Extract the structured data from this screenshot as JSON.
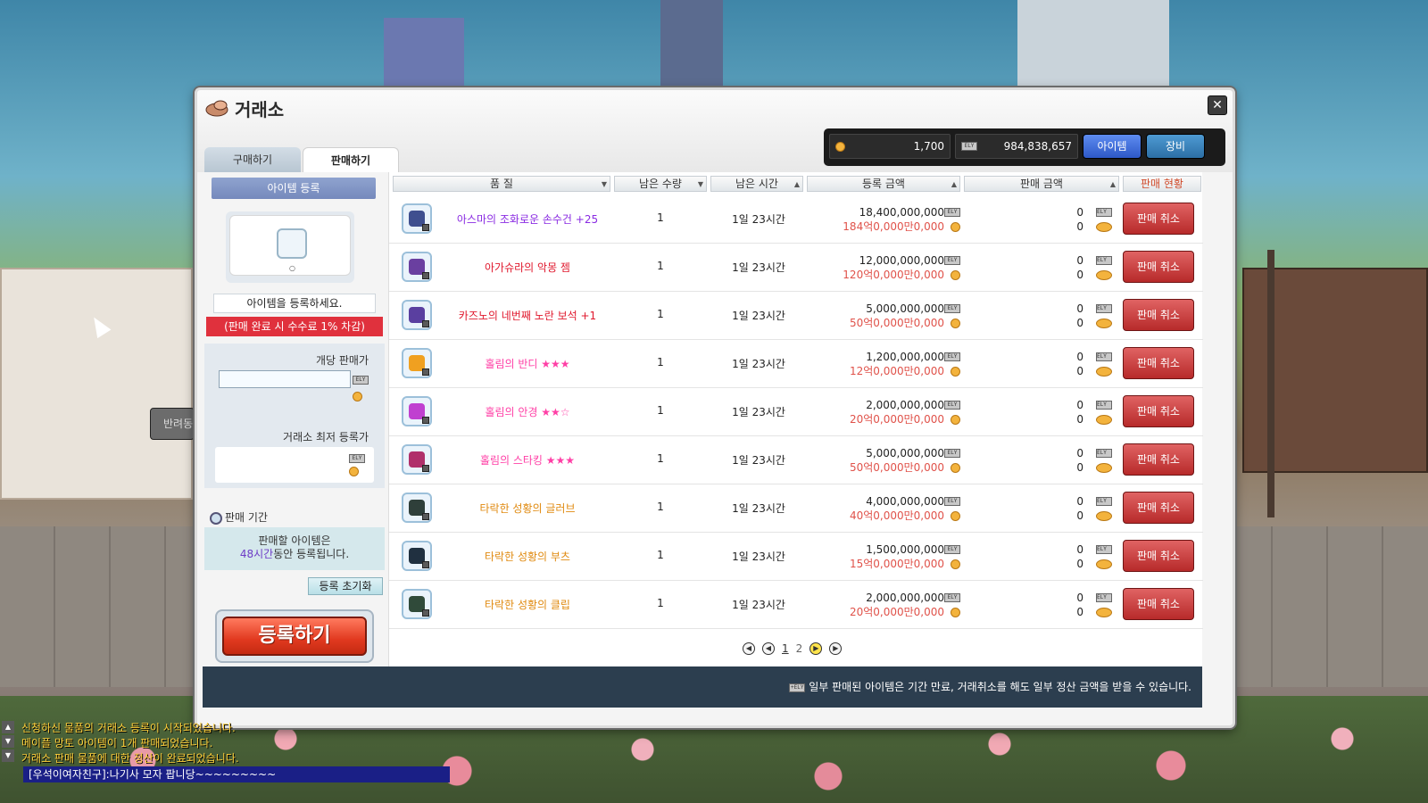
{
  "window": {
    "title": "거래소",
    "close_label": "✕"
  },
  "currency": {
    "coin_amount": "1,700",
    "meso_amount": "984,838,657",
    "meso_label": "ELY",
    "coin_label": "₩"
  },
  "view_toggle": {
    "item_label": "아이템",
    "equip_label": "장비"
  },
  "tabs": {
    "buy": "구매하기",
    "sell": "판매하기"
  },
  "register": {
    "header": "아이템 등록",
    "prompt": "아이템을 등록하세요.",
    "fee_note": "(판매 완료 시 수수료 1% 차감)",
    "unit_price_label": "개당 판매가",
    "unit_price_value": "",
    "lowest_label": "거래소 최저 등록가",
    "period_label": "판매 기간",
    "period_line1": "판매할 아이템은",
    "period_hours": "48시간",
    "period_line2_suffix": "동안 등록됩니다.",
    "reset_label": "등록 초기화",
    "submit_label": "등록하기"
  },
  "table": {
    "columns": [
      "품 질",
      "남은 수량",
      "남은 시간",
      "등록 금액",
      "판매 금액",
      "판매 현황"
    ],
    "rows": [
      {
        "name": "아스마의 조화로운 손수건 +25",
        "name_color": "#8a2be2",
        "qty": "1",
        "time": "1일 23시간",
        "price": "18,400,000,000",
        "price_coin": "184억0,000만0,000",
        "sale_meso": "0",
        "sale_coin": "0",
        "action": "판매 취소",
        "icon": "handkerchief-icon",
        "icon_color": "#3f4f8f"
      },
      {
        "name": "아가슈라의 악몽 젬",
        "name_color": "#e0182d",
        "qty": "1",
        "time": "1일 23시간",
        "price": "12,000,000,000",
        "price_coin": "120억0,000만0,000",
        "sale_meso": "0",
        "sale_coin": "0",
        "action": "판매 취소",
        "icon": "nightmare-gem-icon",
        "icon_color": "#6a3fa0"
      },
      {
        "name": "카즈노의 네번째 노란 보석 +1",
        "name_color": "#e0182d",
        "qty": "1",
        "time": "1일 23시간",
        "price": "5,000,000,000",
        "price_coin": "50억0,000만0,000",
        "sale_meso": "0",
        "sale_coin": "0",
        "action": "판매 취소",
        "icon": "yellow-gem-icon",
        "icon_color": "#5a3fa0"
      },
      {
        "name": "홀림의 반디 ★★★",
        "name_color": "#ff3fa6",
        "qty": "1",
        "time": "1일 23시간",
        "price": "1,200,000,000",
        "price_coin": "12억0,000만0,000",
        "sale_meso": "0",
        "sale_coin": "0",
        "action": "판매 취소",
        "icon": "firefly-icon",
        "icon_color": "#f0a020"
      },
      {
        "name": "홀림의 안경 ★★☆",
        "name_color": "#ff3fa6",
        "qty": "1",
        "time": "1일 23시간",
        "price": "2,000,000,000",
        "price_coin": "20억0,000만0,000",
        "sale_meso": "0",
        "sale_coin": "0",
        "action": "판매 취소",
        "icon": "glasses-icon",
        "icon_color": "#c040d0"
      },
      {
        "name": "홀림의 스타킹 ★★★",
        "name_color": "#ff3fa6",
        "qty": "1",
        "time": "1일 23시간",
        "price": "5,000,000,000",
        "price_coin": "50억0,000만0,000",
        "sale_meso": "0",
        "sale_coin": "0",
        "action": "판매 취소",
        "icon": "stocking-icon",
        "icon_color": "#b0306a"
      },
      {
        "name": "타락한 성황의 글러브",
        "name_color": "#e08a10",
        "qty": "1",
        "time": "1일 23시간",
        "price": "4,000,000,000",
        "price_coin": "40억0,000만0,000",
        "sale_meso": "0",
        "sale_coin": "0",
        "action": "판매 취소",
        "icon": "glove-icon",
        "icon_color": "#2f3f3a"
      },
      {
        "name": "타락한 성황의 부츠",
        "name_color": "#e08a10",
        "qty": "1",
        "time": "1일 23시간",
        "price": "1,500,000,000",
        "price_coin": "15억0,000만0,000",
        "sale_meso": "0",
        "sale_coin": "0",
        "action": "판매 취소",
        "icon": "boots-icon",
        "icon_color": "#203040"
      },
      {
        "name": "타락한 성황의 클립",
        "name_color": "#e08a10",
        "qty": "1",
        "time": "1일 23시간",
        "price": "2,000,000,000",
        "price_coin": "20억0,000만0,000",
        "sale_meso": "0",
        "sale_coin": "0",
        "action": "판매 취소",
        "icon": "clip-icon",
        "icon_color": "#304a3a"
      }
    ]
  },
  "pager": {
    "page1": "1",
    "page2": "2"
  },
  "footer": {
    "note": "일부 판매된 아이템은 기간 만료, 거래취소를 해도 일부 정산 금액을 받을 수 있습니다.",
    "tag": "+ELY"
  },
  "chat": {
    "lines": [
      "신청하신 물품의 거래소 등록이 시작되었습니다.",
      "메이플 망토 아이템이 1개 판매되었습니다.",
      "거래소 판매 물품에 대한 정산이 완료되었습니다."
    ],
    "input": "[우석이여자친구]:나기사 모자 팝니당~~~~~~~~~"
  },
  "side": {
    "label": "반려동"
  }
}
